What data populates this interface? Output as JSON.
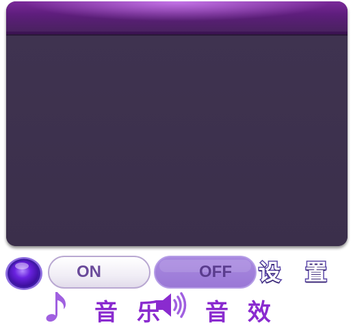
{
  "settings_title": {
    "char1": "设",
    "char2": "置"
  },
  "music": {
    "toggle_on_label": "ON",
    "label": "音 乐"
  },
  "sound_effects": {
    "toggle_off_label": "OFF",
    "label": "音 效"
  },
  "icons": {
    "orb": "purple-orb-button-icon",
    "music": "music-note-icon",
    "sound": "speaker-sound-icon"
  },
  "colors": {
    "panel_bg": "#3c3049",
    "header_purple": "#7b2a9a",
    "label_purple": "#8a2bcf",
    "toggle_on_text": "#6a4a9a",
    "toggle_off_bg": "#a889e0"
  }
}
